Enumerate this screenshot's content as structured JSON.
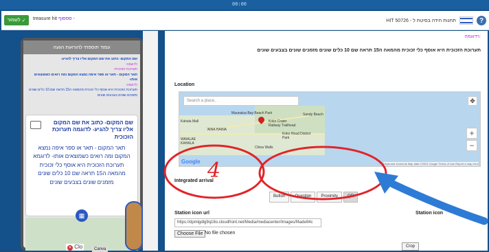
{
  "recording_indicator": "00:00",
  "appbar": {
    "save_label": "לשמור",
    "title_prefix": "ספסוף -",
    "title_name": "treasure hit",
    "help_icon": "?",
    "breadcrumb": "HIT תחנות חידה בסיטת ל - 50726"
  },
  "editor": {
    "header_magenta": ":רדוגמה",
    "hint_text": "תערוכת הזכוכית היא אוסף כלי זכוכית מהמאה ה15 תראה שם 10 כלים שונים מזמנים שונים בצבעים שונים",
    "location_label": "Location",
    "map_search_placeholder": "Search a place..",
    "map_labels": {
      "maunalua_bay": "Maunalua Bay Beach Park",
      "koko_crater": "Koko Crater Railway Trailhead",
      "sandy_beach": "Sandy Beach",
      "aina_haina": "'AINA HAINA",
      "kahala_mall": "Kahala Mall",
      "waialae_kahala": "WAIALAE KAHALA",
      "koko_head": "Koko Head District Park",
      "china_walls": "China Walls",
      "google": "Google",
      "attribution": "Keyboard shortcuts   Map data ©2023 Google   Terms of Use   Report a map error"
    },
    "integrated_arrival_label": "Integrated arrival",
    "arrival_tabs": [
      "Button",
      "Question",
      "Proximity",
      "QR"
    ],
    "selected_tab": "QR",
    "station_icon_url_label": "Station icon url",
    "station_icon_label": "Station icon",
    "station_icon_url_value": "https://dpmlgdlg9q18o.cloudfront.net/Media/mediacenter/Images/f4ade94c",
    "choose_file_label": "Choose File",
    "no_file_text": "No file chosen",
    "crop_label": "Crop",
    "annotation_number": "4"
  },
  "preview": {
    "header": "עמוד תוספתי להוראות הגעה",
    "note_1": "שם המקום- כתוב את שם המקום אליו צריך להגיע-",
    "note_1b": "לדוגמה:",
    "note_2": "תערוכת הזכוכית",
    "note_3": "תאר המקום - תאר או ספר איפה נמצא המקום ומה רואים כשמוצאים אותו-",
    "note_3b": "לדוגמה:",
    "note_4": "תערוכת הזכוכית היא אוסף כלי זכוכית מהמאה ה15 תראה שם 10 כלים שונים מזמנים שונים בצבעים שונים",
    "card_title": "שם המקום- כתוב את שם המקום אליו צריך להגיע- לדוגמה תערוכת הזכוכית",
    "card_body": "תאר המקום - תאר או ספר איפה נמצא המקום ומה רואים כשמוצאים אותו- לדוגמא תערוכת הזכוכית היא אוסף כלי זכוכית מהמאה ה15 תראה שם 10 כלים שונים מזמנים שונים בצבעים שונים",
    "close_label": "Clo",
    "canva_label": "Canva"
  },
  "colors": {
    "background": "#14508a",
    "accent_blue": "#2b58c2",
    "annotation_red": "#e0242a",
    "arrow_blue": "#2e7bd6",
    "save_green": "#3a9a3a"
  }
}
